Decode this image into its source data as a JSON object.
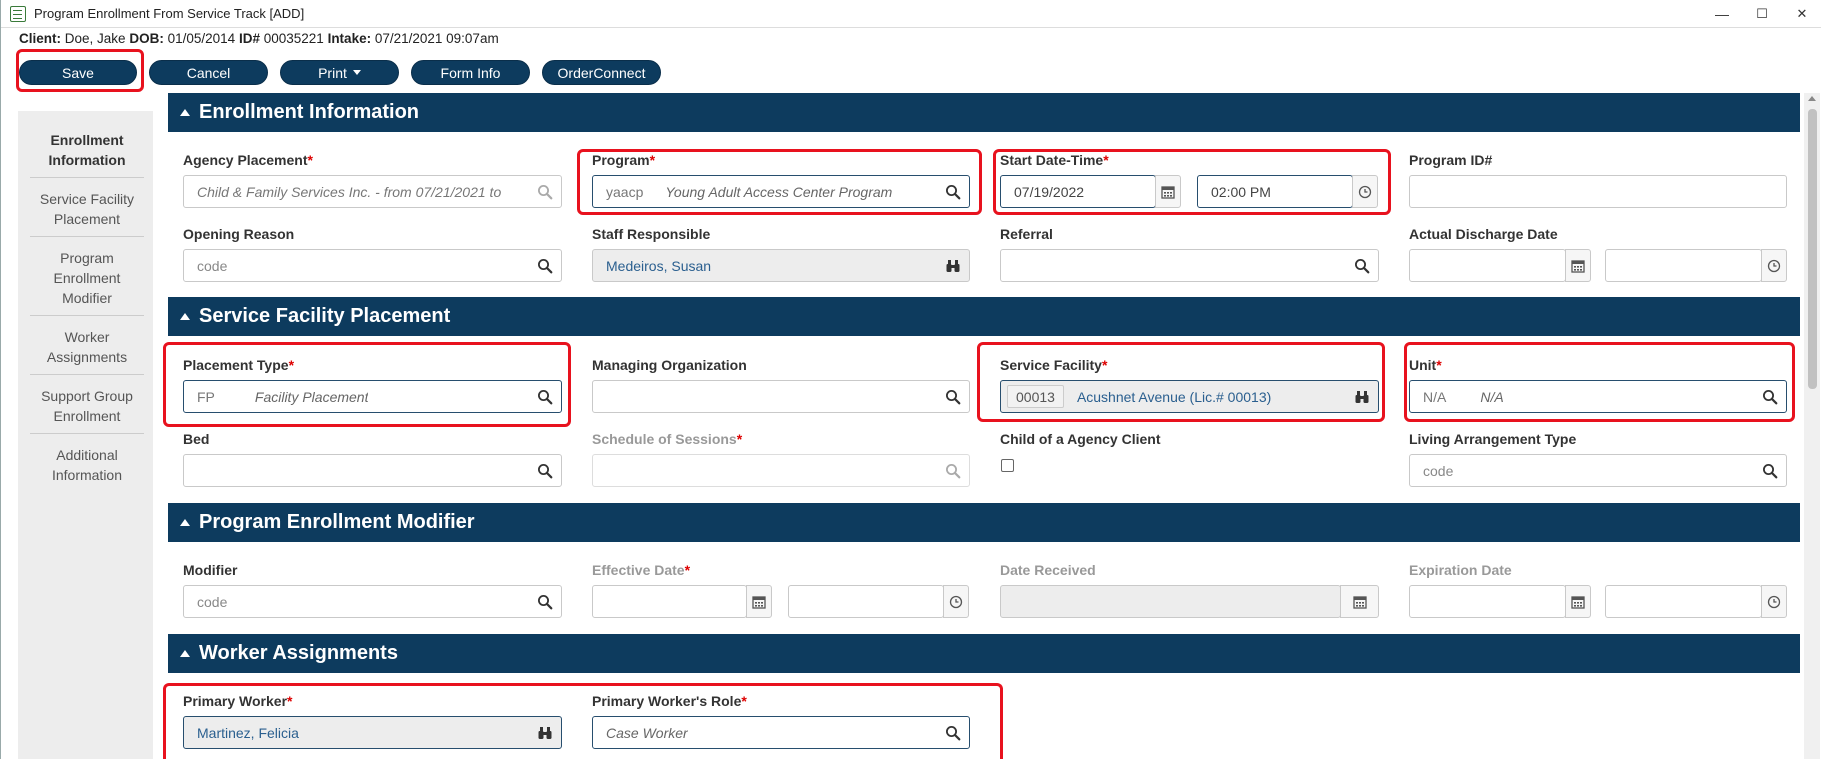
{
  "window": {
    "title": "Program Enrollment From Service Track [ADD]",
    "minimize": "—",
    "maximize": "☐",
    "close": "✕"
  },
  "client": {
    "client_label": "Client:",
    "client_name": "Doe, Jake",
    "dob_label": "DOB:",
    "dob": "01/05/2014",
    "id_label": "ID#",
    "id": "00035221",
    "intake_label": "Intake:",
    "intake": "07/21/2021 09:07am"
  },
  "toolbar": {
    "save": "Save",
    "cancel": "Cancel",
    "print": "Print",
    "form_info": "Form Info",
    "order_connect": "OrderConnect"
  },
  "sidebar": {
    "items": [
      {
        "label": "Enrollment Information"
      },
      {
        "label": "Service Facility Placement"
      },
      {
        "label": "Program Enrollment Modifier"
      },
      {
        "label": "Worker Assignments"
      },
      {
        "label": "Support Group Enrollment"
      },
      {
        "label": "Additional Information"
      }
    ]
  },
  "sections": {
    "enrollment": {
      "title": "Enrollment Information",
      "agency_placement": {
        "label": "Agency Placement",
        "value": "Child & Family Services Inc. - from 07/21/2021 to"
      },
      "program": {
        "label": "Program",
        "code": "yaacp",
        "desc": "Young Adult Access Center Program"
      },
      "start_datetime": {
        "label": "Start Date-Time",
        "date": "07/19/2022",
        "time": "02:00 PM"
      },
      "program_id": {
        "label": "Program ID#",
        "value": ""
      },
      "opening_reason": {
        "label": "Opening Reason",
        "placeholder": "code"
      },
      "staff_responsible": {
        "label": "Staff Responsible",
        "value": "Medeiros, Susan"
      },
      "referral": {
        "label": "Referral",
        "value": ""
      },
      "actual_discharge": {
        "label": "Actual Discharge Date",
        "date": "",
        "time": ""
      }
    },
    "service_facility": {
      "title": "Service Facility Placement",
      "placement_type": {
        "label": "Placement Type",
        "code": "FP",
        "desc": "Facility Placement"
      },
      "managing_org": {
        "label": "Managing Organization",
        "value": ""
      },
      "service_facility": {
        "label": "Service Facility",
        "code": "00013",
        "value": "Acushnet Avenue (Lic.# 00013)"
      },
      "unit": {
        "label": "Unit",
        "code": "N/A",
        "desc": "N/A"
      },
      "bed": {
        "label": "Bed",
        "value": ""
      },
      "schedule": {
        "label": "Schedule of Sessions",
        "value": ""
      },
      "child_of_agency": {
        "label": "Child of a Agency Client",
        "checked": false
      },
      "living_arrangement": {
        "label": "Living Arrangement Type",
        "placeholder": "code"
      }
    },
    "modifier": {
      "title": "Program Enrollment Modifier",
      "modifier": {
        "label": "Modifier",
        "placeholder": "code"
      },
      "effective_date": {
        "label": "Effective Date"
      },
      "date_received": {
        "label": "Date Received"
      },
      "expiration_date": {
        "label": "Expiration Date"
      }
    },
    "workers": {
      "title": "Worker Assignments",
      "primary_worker": {
        "label": "Primary Worker",
        "value": "Martinez, Felicia"
      },
      "primary_role": {
        "label": "Primary Worker's Role",
        "desc": "Case Worker"
      }
    }
  },
  "required_mark": "*",
  "colors": {
    "header": "#0d3b5e",
    "highlight": "#e8121e",
    "required": "#dd0000",
    "link": "#2a5f8f"
  }
}
